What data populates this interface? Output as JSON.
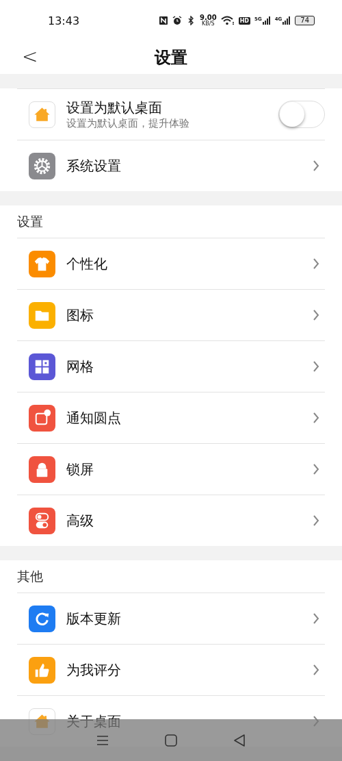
{
  "status_bar": {
    "time": "13:43",
    "speed": "9.00",
    "speed_unit": "KB/S",
    "hd": "HD",
    "signal_1": "5G",
    "signal_2": "4G",
    "battery": "74"
  },
  "header": {
    "back": "<",
    "title": "设置"
  },
  "top_card": {
    "default_launcher": {
      "title": "设置为默认桌面",
      "subtitle": "设置为默认桌面，提升体验",
      "on": false
    },
    "system": {
      "label": "系统设置"
    }
  },
  "sections": [
    {
      "title": "设置",
      "items": [
        {
          "label": "个性化"
        },
        {
          "label": "图标"
        },
        {
          "label": "网格"
        },
        {
          "label": "通知圆点"
        },
        {
          "label": "锁屏"
        },
        {
          "label": "高级"
        }
      ]
    },
    {
      "title": "其他",
      "items": [
        {
          "label": "版本更新"
        },
        {
          "label": "为我评分"
        },
        {
          "label": "关于桌面"
        }
      ]
    }
  ]
}
